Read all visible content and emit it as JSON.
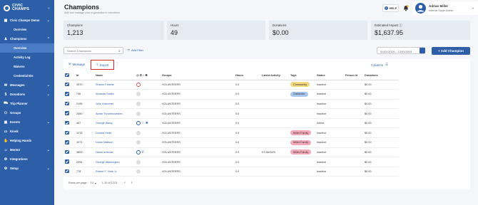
{
  "sidebar": {
    "logo_line1": "CIVIC",
    "logo_line2": "CHAMPS",
    "collapse_icon": "double-chevron-left",
    "items": [
      {
        "label": "Civic Champs Demo",
        "icon": "building-icon",
        "chevron": "▾",
        "type": "item"
      },
      {
        "label": "Overview",
        "type": "sub"
      },
      {
        "label": "Champions",
        "icon": "person-icon",
        "chevron": "▴",
        "type": "item"
      },
      {
        "label": "Overview",
        "type": "sub",
        "active": true
      },
      {
        "label": "Activity Log",
        "type": "sub"
      },
      {
        "label": "Waivers",
        "type": "sub"
      },
      {
        "label": "Credential IDs",
        "type": "sub"
      },
      {
        "label": "Messages",
        "icon": "chat-icon",
        "chevron": "▾",
        "type": "item"
      },
      {
        "label": "Donations",
        "icon": "donation-icon",
        "chevron": "▾",
        "type": "item"
      },
      {
        "label": "Trip Planner",
        "icon": "car-icon",
        "type": "item"
      },
      {
        "label": "Groups",
        "icon": "group-icon",
        "type": "item"
      },
      {
        "label": "Events",
        "icon": "calendar-icon",
        "chevron": "▾",
        "type": "item"
      },
      {
        "label": "Kiosk",
        "icon": "kiosk-icon",
        "type": "item"
      },
      {
        "label": "Helping Hands",
        "icon": "hands-icon",
        "type": "item"
      },
      {
        "label": "Mentor",
        "icon": "mentor-icon",
        "chevron": "▾",
        "type": "item"
      },
      {
        "label": "Integrations",
        "icon": "integrations-icon",
        "type": "item"
      },
      {
        "label": "Setup",
        "icon": "gear-icon",
        "chevron": "▾",
        "type": "item"
      }
    ]
  },
  "header": {
    "title": "Champions",
    "subtitle": "Add and manage your organization's volunteers",
    "help_label": "HELP",
    "user_name": "Adrian Miller",
    "user_role": "Internal Super Admin"
  },
  "stats": [
    {
      "label": "Champions",
      "value": "1,213"
    },
    {
      "label": "Hours",
      "value": "49"
    },
    {
      "label": "Donations",
      "value": "$0.00"
    },
    {
      "label": "Estimated Impact",
      "value": "$1,637.95"
    }
  ],
  "toolbar": {
    "search_placeholder": "Search Champions",
    "add_filter_label": "Add Filter",
    "date_range": "01/01/2024 – 12/31/2024",
    "add_champion_label": "+ Add Champion",
    "message_label": "Message",
    "export_label": "Export",
    "columns_label": "Columns"
  },
  "table": {
    "headers": [
      "Id",
      "Name",
      "",
      "Groups",
      "Hours",
      "Latest Activity",
      "Tags",
      "Status",
      "Person Id",
      "Donations"
    ],
    "rows": [
      {
        "id": "4370",
        "name": "Sharon Fanelle",
        "group": "VOLUNTEERS",
        "hours": "0.0",
        "latest": "",
        "tag": "Community",
        "tag_color": "yellow",
        "status": "Inactive",
        "person_id": "",
        "donations": "$0.00",
        "icons": "red"
      },
      {
        "id": "746",
        "name": "Amanda Sosko",
        "group": "VOLUNTEERS",
        "hours": "0.0",
        "latest": "",
        "tag": "Gatlander",
        "tag_color": "blue",
        "status": "Inactive",
        "person_id": "",
        "donations": "$0.00",
        "icons": "grey"
      },
      {
        "id": "2195",
        "name": "Julie Holcomer",
        "group": "VOLUNTEERS",
        "hours": "0.0",
        "latest": "",
        "tag": "",
        "tag_color": "",
        "status": "Inactive",
        "person_id": "",
        "donations": "$0.00",
        "icons": "grey"
      },
      {
        "id": "2350",
        "name": "Andre Throethouesten",
        "group": "VOLUNTEERS",
        "hours": "0.0",
        "latest": "",
        "tag": "",
        "tag_color": "",
        "status": "Inactive",
        "person_id": "",
        "donations": "$0.00",
        "icons": "grey"
      },
      {
        "id": "467",
        "name": "George Wang",
        "group": "VOLUNTEERS",
        "hours": "0.0",
        "latest": "",
        "tag": "",
        "tag_color": "",
        "status": "Active",
        "person_id": "",
        "donations": "$0.00",
        "icons": "full"
      },
      {
        "id": "1078",
        "name": "Donald Hinks",
        "group": "VOLUNTEERS",
        "hours": "0.0",
        "latest": "",
        "tag": "Miller Family",
        "tag_color": "pink",
        "status": "Inactive",
        "person_id": "",
        "donations": "$0.00",
        "icons": "grey"
      },
      {
        "id": "1071",
        "name": "Diane Mattson",
        "group": "VOLUNTEERS",
        "hours": "0.0",
        "latest": "",
        "tag": "Miller Family",
        "tag_color": "pink",
        "status": "Inactive",
        "person_id": "",
        "donations": "$0.00",
        "icons": "grey"
      },
      {
        "id": "3800",
        "name": "Haroe antonaz",
        "group": "VOLUNTEERS",
        "hours": "0.0",
        "latest": "07/18/2020",
        "tag": "Miller Family",
        "tag_color": "pink",
        "status": "Inactive",
        "person_id": "",
        "donations": "$0.00",
        "icons": "phone"
      },
      {
        "id": "2394",
        "name": "George Washington",
        "group": "VOLUNTEERS",
        "hours": "0.0",
        "latest": "",
        "tag": "",
        "tag_color": "",
        "status": "Inactive",
        "person_id": "",
        "donations": "$0.00",
        "icons": "grey"
      },
      {
        "id": "778",
        "name": "Robert F. Yoda Jr.",
        "group": "VOLUNTEERS",
        "hours": "0.0",
        "latest": "",
        "tag": "",
        "tag_color": "",
        "status": "Inactive",
        "person_id": "",
        "donations": "$0.00",
        "icons": "grey"
      }
    ]
  },
  "pagination": {
    "rows_label": "Rows per page:",
    "rows_value": "10",
    "range": "1-10 of 1213"
  },
  "colors": {
    "brand": "#2c5fa8",
    "highlight": "#d9252d"
  }
}
